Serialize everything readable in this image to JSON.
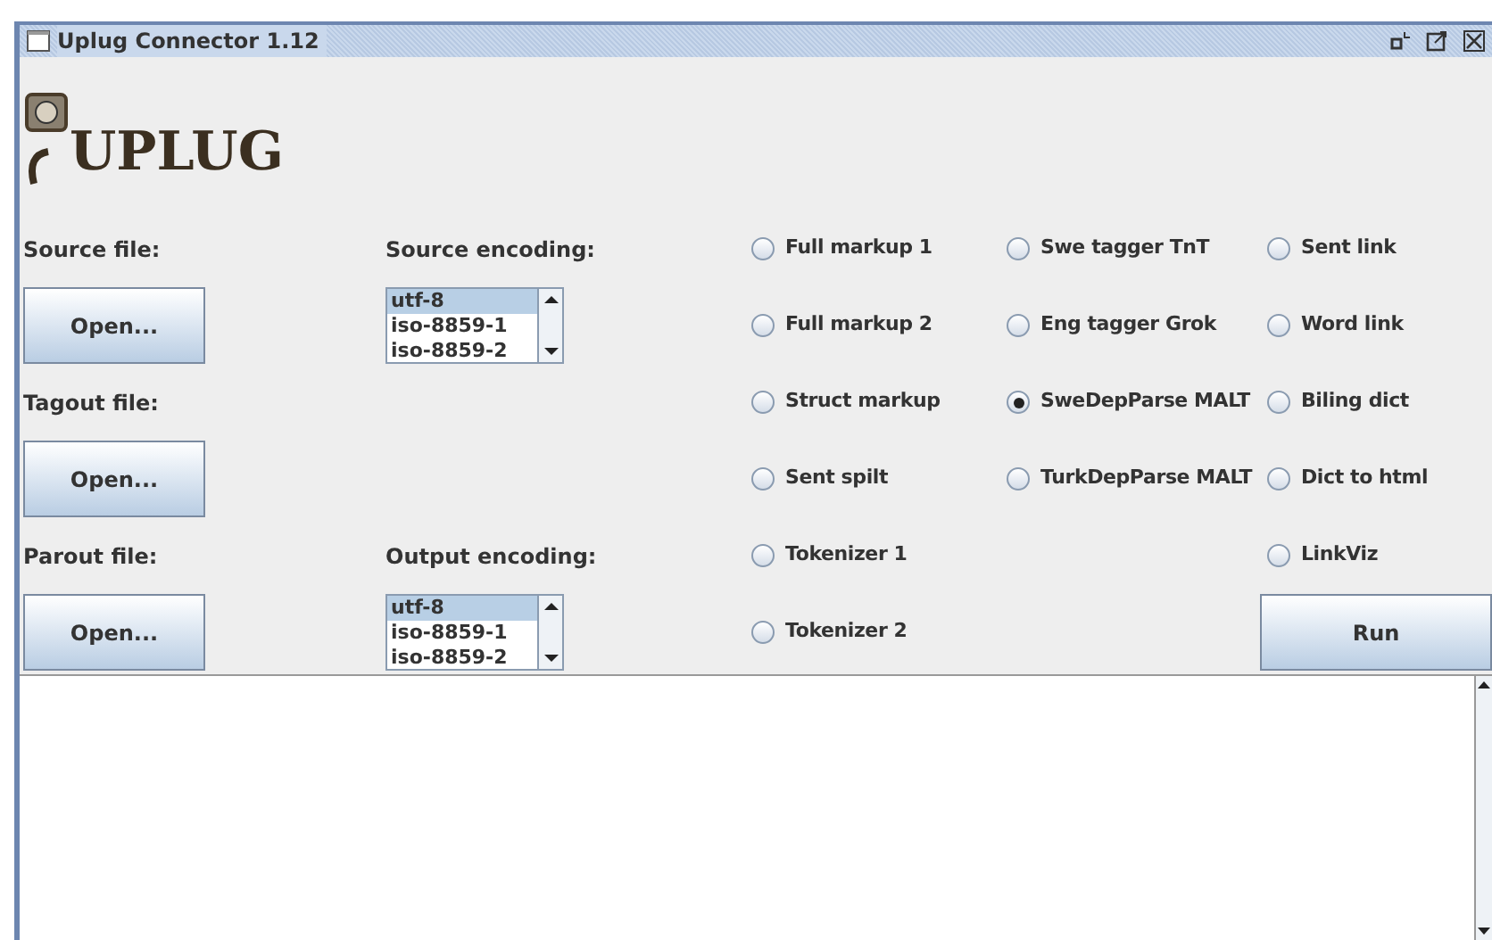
{
  "window": {
    "title": "Uplug Connector 1.12"
  },
  "logo": {
    "text": "UPLUG"
  },
  "file_rows": [
    {
      "label": "Source file:",
      "button": "Open...",
      "encoding": {
        "label": "Source encoding:",
        "items": [
          {
            "text": "utf-8",
            "selected": true
          },
          {
            "text": "iso-8859-1",
            "selected": false
          },
          {
            "text": "iso-8859-2",
            "selected": false
          }
        ]
      }
    },
    {
      "label": "Tagout file:",
      "button": "Open..."
    },
    {
      "label": "Parout file:",
      "button": "Open...",
      "encoding": {
        "label": "Output encoding:",
        "items": [
          {
            "text": "utf-8",
            "selected": true
          },
          {
            "text": "iso-8859-1",
            "selected": false
          },
          {
            "text": "iso-8859-2",
            "selected": false
          }
        ]
      }
    }
  ],
  "options": [
    [
      {
        "label": "Full markup 1",
        "selected": false
      },
      {
        "label": "Full markup 2",
        "selected": false
      },
      {
        "label": "Struct markup",
        "selected": false
      },
      {
        "label": "Sent spilt",
        "selected": false
      },
      {
        "label": "Tokenizer 1",
        "selected": false
      },
      {
        "label": "Tokenizer 2",
        "selected": false
      }
    ],
    [
      {
        "label": "Swe tagger TnT",
        "selected": false
      },
      {
        "label": "Eng tagger Grok",
        "selected": false
      },
      {
        "label": "SweDepParse MALT",
        "selected": true
      },
      {
        "label": "TurkDepParse MALT",
        "selected": false
      }
    ],
    [
      {
        "label": "Sent link",
        "selected": false
      },
      {
        "label": "Word link",
        "selected": false
      },
      {
        "label": "Biling dict",
        "selected": false
      },
      {
        "label": "Dict to html",
        "selected": false
      },
      {
        "label": "LinkViz",
        "selected": false
      }
    ]
  ],
  "run_button": "Run"
}
